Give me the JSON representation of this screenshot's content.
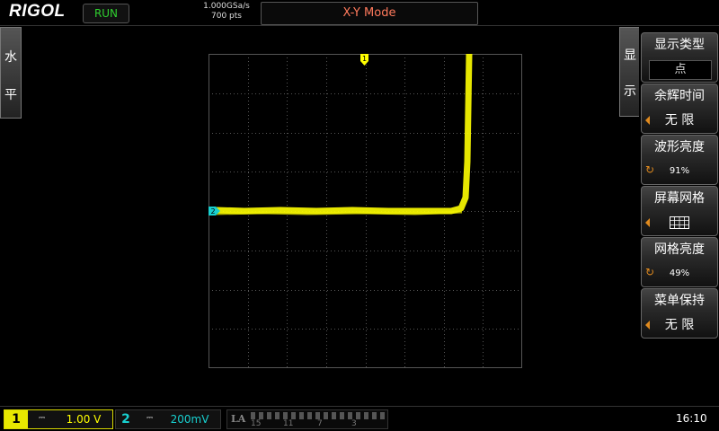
{
  "header": {
    "brand": "RIGOL",
    "run_state": "RUN",
    "sample_rate": "1.000GSa/s",
    "memory_depth": "700 pts",
    "mode_title": "X-Y Mode"
  },
  "left_tab": {
    "label_line1": "水",
    "label_line2": "平"
  },
  "right_tab": {
    "label_line1": "显",
    "label_line2": "示"
  },
  "menu": {
    "items": [
      {
        "label": "显示类型",
        "value": "点"
      },
      {
        "label": "余辉时间",
        "value": "无  限"
      },
      {
        "label": "波形亮度",
        "value": "91%"
      },
      {
        "label": "屏幕网格",
        "value": ""
      },
      {
        "label": "网格亮度",
        "value": "49%"
      },
      {
        "label": "菜单保持",
        "value": "无  限"
      }
    ]
  },
  "waveform": {
    "channel_marker_top": "1",
    "channel_marker_left": "2",
    "trace_color": "#ffff00",
    "marker1_color": "#ffff00",
    "marker2_color": "#18d0d0"
  },
  "bottom": {
    "ch1": {
      "number": "1",
      "coupling": "⎓",
      "scale": "1.00 V"
    },
    "ch2": {
      "number": "2",
      "coupling": "⎓",
      "scale": "200mV"
    },
    "la": {
      "label": "LA",
      "indices": [
        "15",
        "11",
        "7",
        "3"
      ]
    },
    "clock": "16:10"
  },
  "colors": {
    "ch1": "#e8e800",
    "ch2": "#18d0d0",
    "mode_title": "#ff7a5c",
    "run": "#2fd02f",
    "accent": "#e08a1e"
  }
}
